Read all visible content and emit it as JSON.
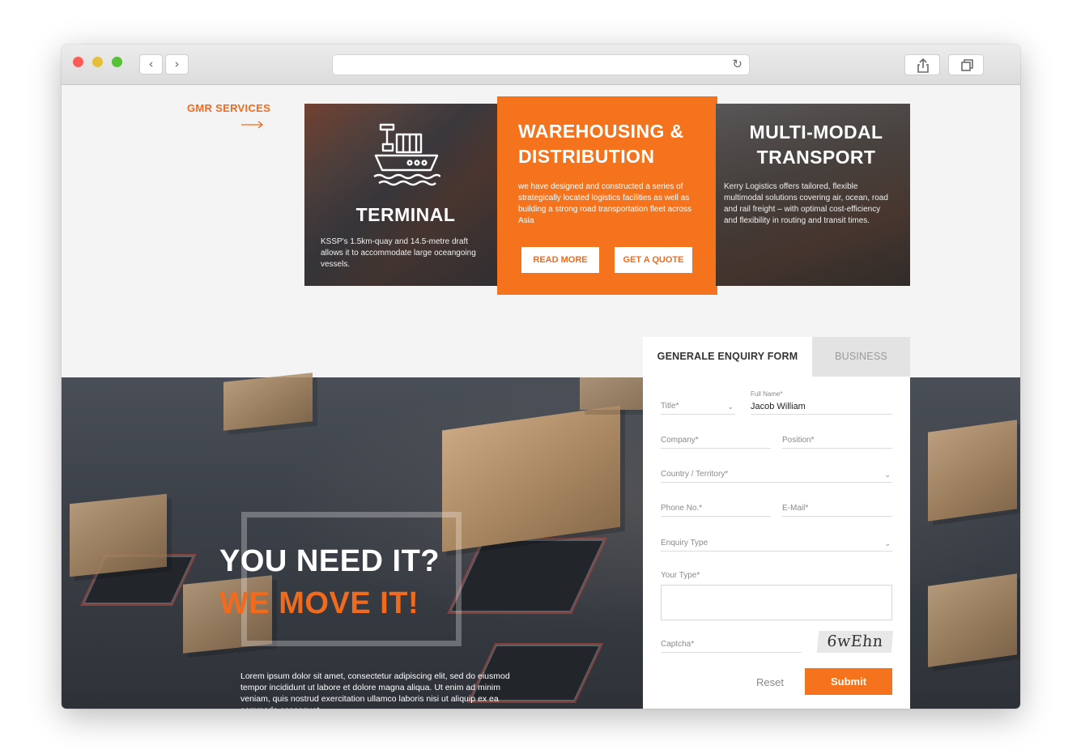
{
  "browser": {
    "back_icon": "chevron-left-icon",
    "forward_icon": "chevron-right-icon",
    "reload_icon": "reload-icon",
    "share_icon": "share-icon",
    "tabs_icon": "tabs-icon",
    "url": ""
  },
  "colors": {
    "accent": "#f26b1d",
    "accent_fill": "#f4731c"
  },
  "services": {
    "label": "GMR SERVICES",
    "arrow_icon": "arrow-right-icon",
    "terminal": {
      "title": "TERMINAL",
      "icon": "cargo-ship-icon",
      "description": "KSSP's 1.5km-quay and 14.5-metre draft allows it to accommodate large oceangoing vessels."
    },
    "warehousing": {
      "title_line1": "WAREHOUSING &",
      "title_line2": "DISTRIBUTION",
      "description": "we have designed and constructed a series of strategically located logistics facilities as well as building a strong road transportation fleet across Asia",
      "read_more": "READ MORE",
      "get_quote": "GET A QUOTE"
    },
    "multimodal": {
      "title_line1": "MULTI-MODAL",
      "title_line2": "TRANSPORT",
      "description": "Kerry Logistics offers tailored, flexible multimodal solutions covering air, ocean, road and rail freight – with optimal cost-efficiency and flexibility in routing and transit times."
    }
  },
  "hero": {
    "line1": "YOU NEED IT?",
    "line2": "WE MOVE IT!",
    "paragraph": "Lorem ipsum dolor sit amet, consectetur adipiscing elit, sed do eiusmod tempor incididunt ut labore et dolore magna aliqua. Ut enim ad minim veniam, quis nostrud exercitation ullamco laboris nisi ut aliquip ex ea commodo consequat."
  },
  "form": {
    "tab_general": "GENERALE ENQUIRY FORM",
    "tab_business": "BUSINESS",
    "title_label": "Title*",
    "fullname_label": "Full Name*",
    "fullname_value": "Jacob William",
    "company_label": "Company*",
    "position_label": "Position*",
    "country_label": "Country / Territory*",
    "phone_label": "Phone No.*",
    "email_label": "E-Mail*",
    "enquiry_label": "Enquiry Type",
    "your_type_label": "Your Type*",
    "captcha_label": "Captcha*",
    "captcha_text": "6wEhn",
    "reset": "Reset",
    "submit": "Submit"
  }
}
